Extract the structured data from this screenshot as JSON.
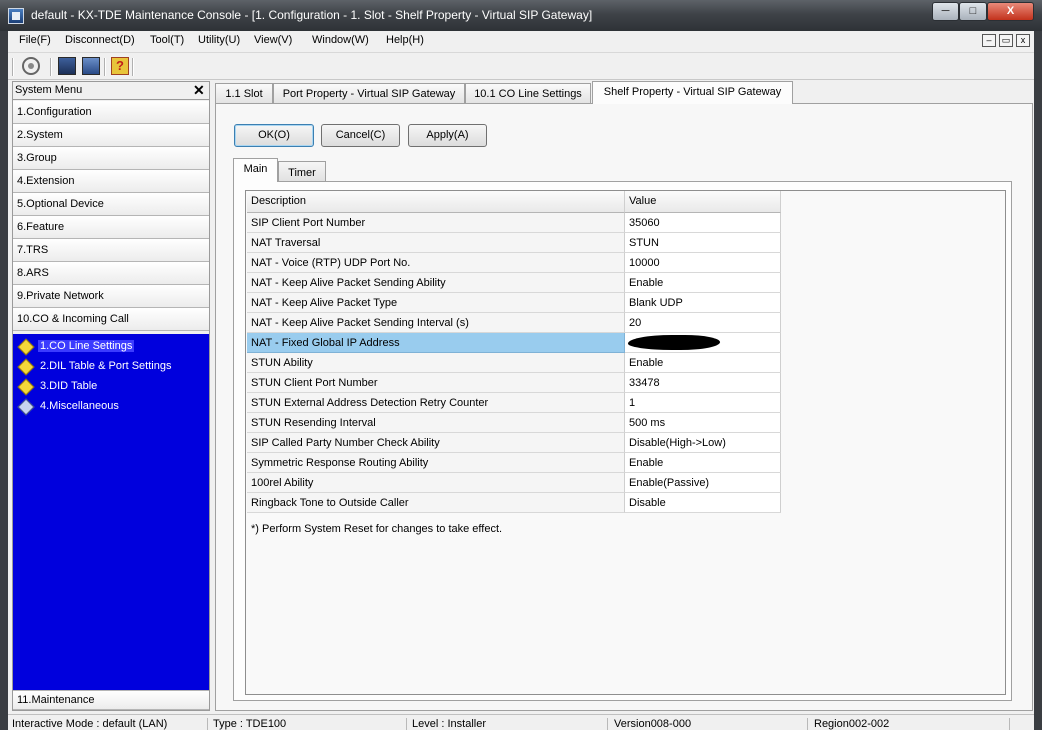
{
  "window": {
    "title": "default - KX-TDE Maintenance Console - [1. Configuration - 1. Slot - Shelf Property - Virtual SIP Gateway]",
    "controls": {
      "minimize": "─",
      "maximize": "□",
      "close": "X"
    }
  },
  "menubar": {
    "items": [
      "File(F)",
      "Disconnect(D)",
      "Tool(T)",
      "Utility(U)",
      "View(V)",
      "Window(W)",
      "Help(H)"
    ],
    "mdi_controls": [
      "–",
      "▭",
      "x"
    ]
  },
  "toolbar": {
    "icons": [
      "gear-icon",
      "computer-icon",
      "computer-user-icon",
      "help-icon"
    ],
    "help_glyph": "?"
  },
  "sidebar": {
    "title": "System Menu",
    "close": "✕",
    "items": [
      "1.Configuration",
      "2.System",
      "3.Group",
      "4.Extension",
      "5.Optional Device",
      "6.Feature",
      "7.TRS",
      "8.ARS",
      "9.Private Network",
      "10.CO & Incoming Call"
    ],
    "sub_items": [
      "1.CO Line Settings",
      "2.DIL Table & Port Settings",
      "3.DID Table",
      "4.Miscellaneous"
    ],
    "footer_item": "11.Maintenance",
    "colors": {
      "sub_panel_bg": "#0000dd"
    }
  },
  "tabs": [
    "1.1 Slot",
    "Port Property - Virtual SIP Gateway",
    "10.1 CO Line Settings",
    "Shelf Property - Virtual SIP Gateway"
  ],
  "buttons": {
    "ok": "OK(O)",
    "cancel": "Cancel(C)",
    "apply": "Apply(A)"
  },
  "subtabs": [
    "Main",
    "Timer"
  ],
  "grid": {
    "columns": [
      "Description",
      "Value"
    ],
    "rows": [
      {
        "description": "SIP Client Port Number",
        "value": "35060"
      },
      {
        "description": "NAT Traversal",
        "value": "STUN"
      },
      {
        "description": "NAT - Voice (RTP) UDP Port No.",
        "value": "10000"
      },
      {
        "description": "NAT - Keep Alive Packet Sending Ability",
        "value": "Enable"
      },
      {
        "description": "NAT - Keep Alive Packet Type",
        "value": "Blank UDP"
      },
      {
        "description": "NAT - Keep Alive Packet Sending Interval (s)",
        "value": "20"
      },
      {
        "description": "NAT - Fixed Global IP Address",
        "value": ""
      },
      {
        "description": "STUN Ability",
        "value": "Enable"
      },
      {
        "description": "STUN Client Port Number",
        "value": "33478"
      },
      {
        "description": "STUN External Address Detection Retry Counter",
        "value": "1"
      },
      {
        "description": "STUN Resending Interval",
        "value": "500 ms"
      },
      {
        "description": "SIP Called Party Number Check Ability",
        "value": "Disable(High->Low)"
      },
      {
        "description": "Symmetric Response Routing Ability",
        "value": "Enable"
      },
      {
        "description": "100rel Ability",
        "value": "Enable(Passive)"
      },
      {
        "description": "Ringback Tone to Outside Caller",
        "value": "Disable"
      }
    ],
    "note": "*) Perform System Reset for changes to take effect."
  },
  "statusbar": {
    "mode": "Interactive Mode : default (LAN)",
    "type": "Type : TDE100",
    "level": "Level : Installer",
    "version": "Version008-000",
    "region": "Region002-002"
  }
}
